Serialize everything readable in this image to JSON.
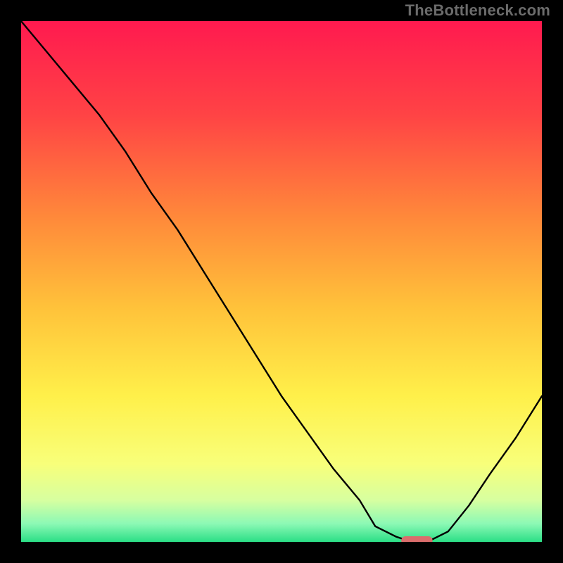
{
  "watermark": "TheBottleneck.com",
  "marker_color": "#da6d6c",
  "chart_data": {
    "type": "line",
    "title": "",
    "xlabel": "",
    "ylabel": "",
    "xlim": [
      0,
      100
    ],
    "ylim": [
      0,
      100
    ],
    "grid": false,
    "x": [
      0,
      5,
      10,
      15,
      20,
      25,
      30,
      35,
      40,
      45,
      50,
      55,
      60,
      65,
      68,
      72,
      75,
      78,
      82,
      86,
      90,
      95,
      100
    ],
    "values": [
      100,
      94,
      88,
      82,
      75,
      67,
      60,
      52,
      44,
      36,
      28,
      21,
      14,
      8,
      3,
      1,
      0,
      0,
      2,
      7,
      13,
      20,
      28
    ],
    "marker": {
      "x_start": 73,
      "x_end": 79,
      "y": 0
    },
    "gradient_stops": [
      {
        "t": 0.0,
        "c": "#ff1a4f"
      },
      {
        "t": 0.18,
        "c": "#ff4345"
      },
      {
        "t": 0.38,
        "c": "#ff8a3a"
      },
      {
        "t": 0.55,
        "c": "#ffc23a"
      },
      {
        "t": 0.72,
        "c": "#fff04a"
      },
      {
        "t": 0.85,
        "c": "#f8ff7a"
      },
      {
        "t": 0.92,
        "c": "#d7ffa0"
      },
      {
        "t": 0.965,
        "c": "#8cf9b5"
      },
      {
        "t": 1.0,
        "c": "#2bdf86"
      }
    ]
  }
}
